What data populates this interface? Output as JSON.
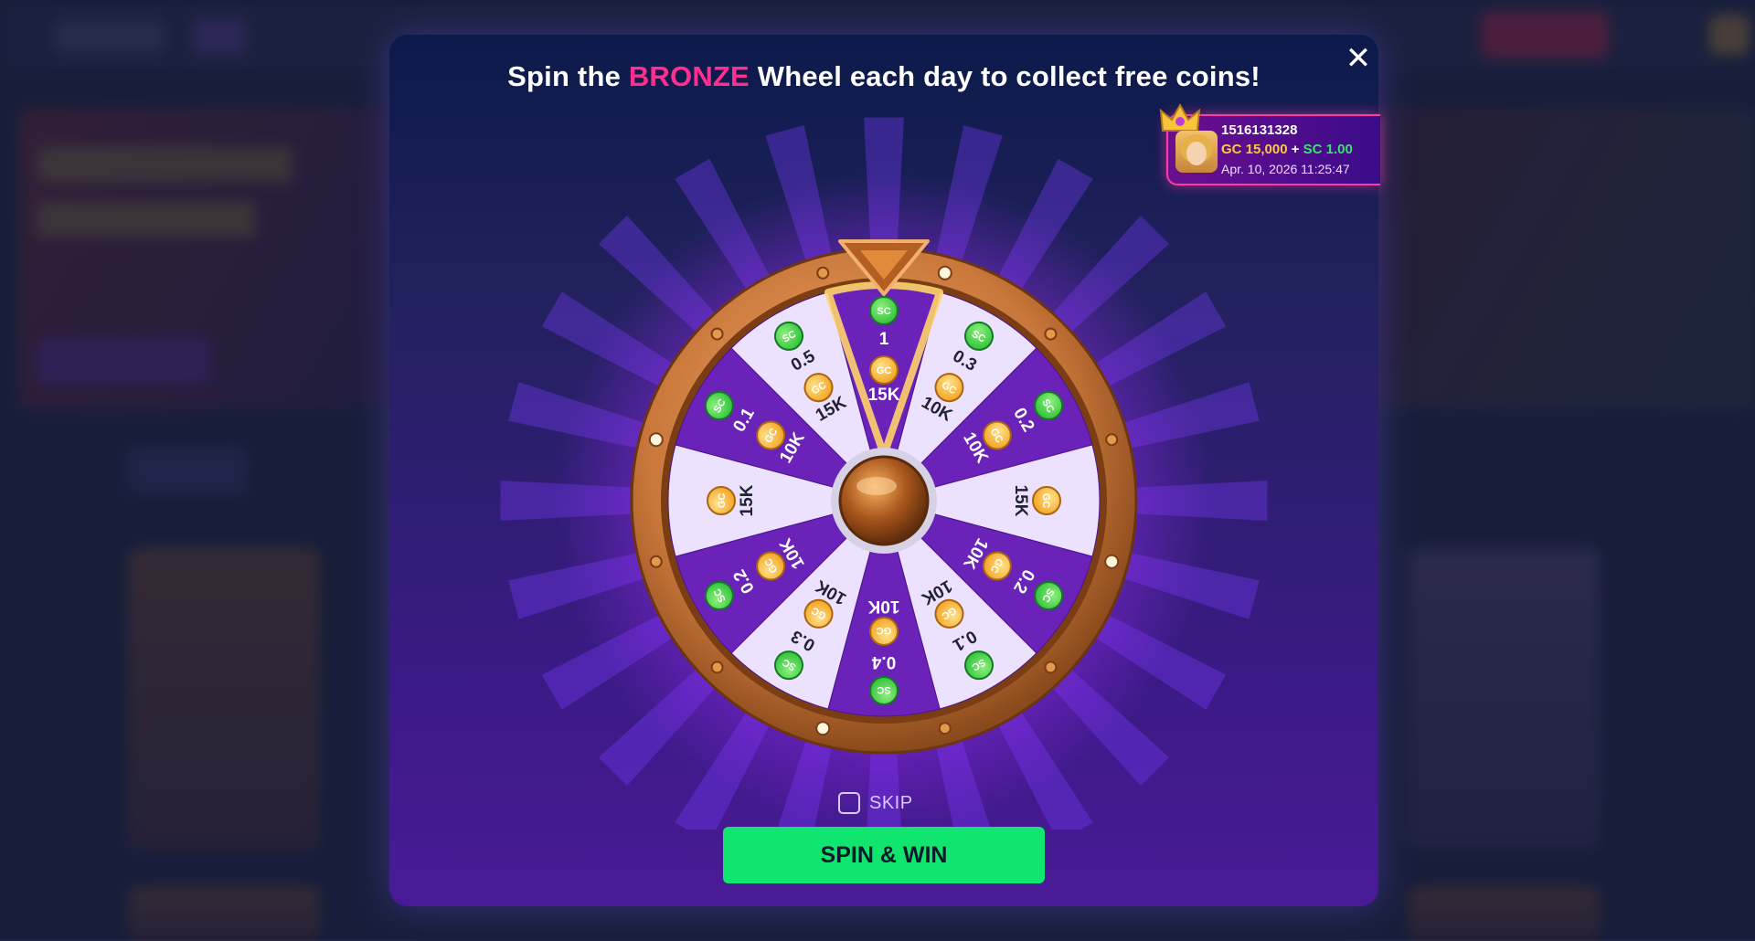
{
  "modal": {
    "title_prefix": "Spin the ",
    "title_accent": "BRONZE",
    "title_suffix": " Wheel each day to collect free coins!",
    "close_symbol": "✕"
  },
  "wheel": {
    "segments": [
      {
        "top": "1",
        "bottom": "15K",
        "top_coin": "SC",
        "bottom_coin": "GC",
        "shade": "dark"
      },
      {
        "top": "0.3",
        "bottom": "10K",
        "top_coin": "SC",
        "bottom_coin": "GC",
        "shade": "light"
      },
      {
        "top": "0.2",
        "bottom": "10K",
        "top_coin": "SC",
        "bottom_coin": "GC",
        "shade": "dark"
      },
      {
        "top": "",
        "bottom": "15K",
        "top_coin": "",
        "bottom_coin": "GC",
        "shade": "light"
      },
      {
        "top": "0.2",
        "bottom": "10K",
        "top_coin": "SC",
        "bottom_coin": "GC",
        "shade": "dark"
      },
      {
        "top": "0.1",
        "bottom": "10K",
        "top_coin": "SC",
        "bottom_coin": "GC",
        "shade": "light"
      },
      {
        "top": "0.4",
        "bottom": "10K",
        "top_coin": "SC",
        "bottom_coin": "GC",
        "shade": "dark"
      },
      {
        "top": "0.3",
        "bottom": "10K",
        "top_coin": "SC",
        "bottom_coin": "GC",
        "shade": "light"
      },
      {
        "top": "0.2",
        "bottom": "10K",
        "top_coin": "SC",
        "bottom_coin": "GC",
        "shade": "dark"
      },
      {
        "top": "",
        "bottom": "15K",
        "top_coin": "",
        "bottom_coin": "GC",
        "shade": "light"
      },
      {
        "top": "0.1",
        "bottom": "10K",
        "top_coin": "SC",
        "bottom_coin": "GC",
        "shade": "dark"
      },
      {
        "top": "0.5",
        "bottom": "15K",
        "top_coin": "SC",
        "bottom_coin": "GC",
        "shade": "light"
      }
    ],
    "colors": {
      "dark_segment": "#6a22b8",
      "light_segment": "#ece2ff",
      "rim": "#c9773a",
      "glow": "#a12cff",
      "sc_coin": "#2fbf3a",
      "gc_coin": "#f2a21e",
      "highlight": "#ffd36a"
    }
  },
  "winner": {
    "id": "1516131328",
    "gc": "GC 15,000",
    "plus": "+",
    "sc": "SC 1.00",
    "datetime": "Apr. 10, 2026 11:25:47"
  },
  "skip": {
    "label": "SKIP",
    "checked": false
  },
  "spin_button": {
    "label": "SPIN & WIN",
    "color": "#0fe56f"
  }
}
